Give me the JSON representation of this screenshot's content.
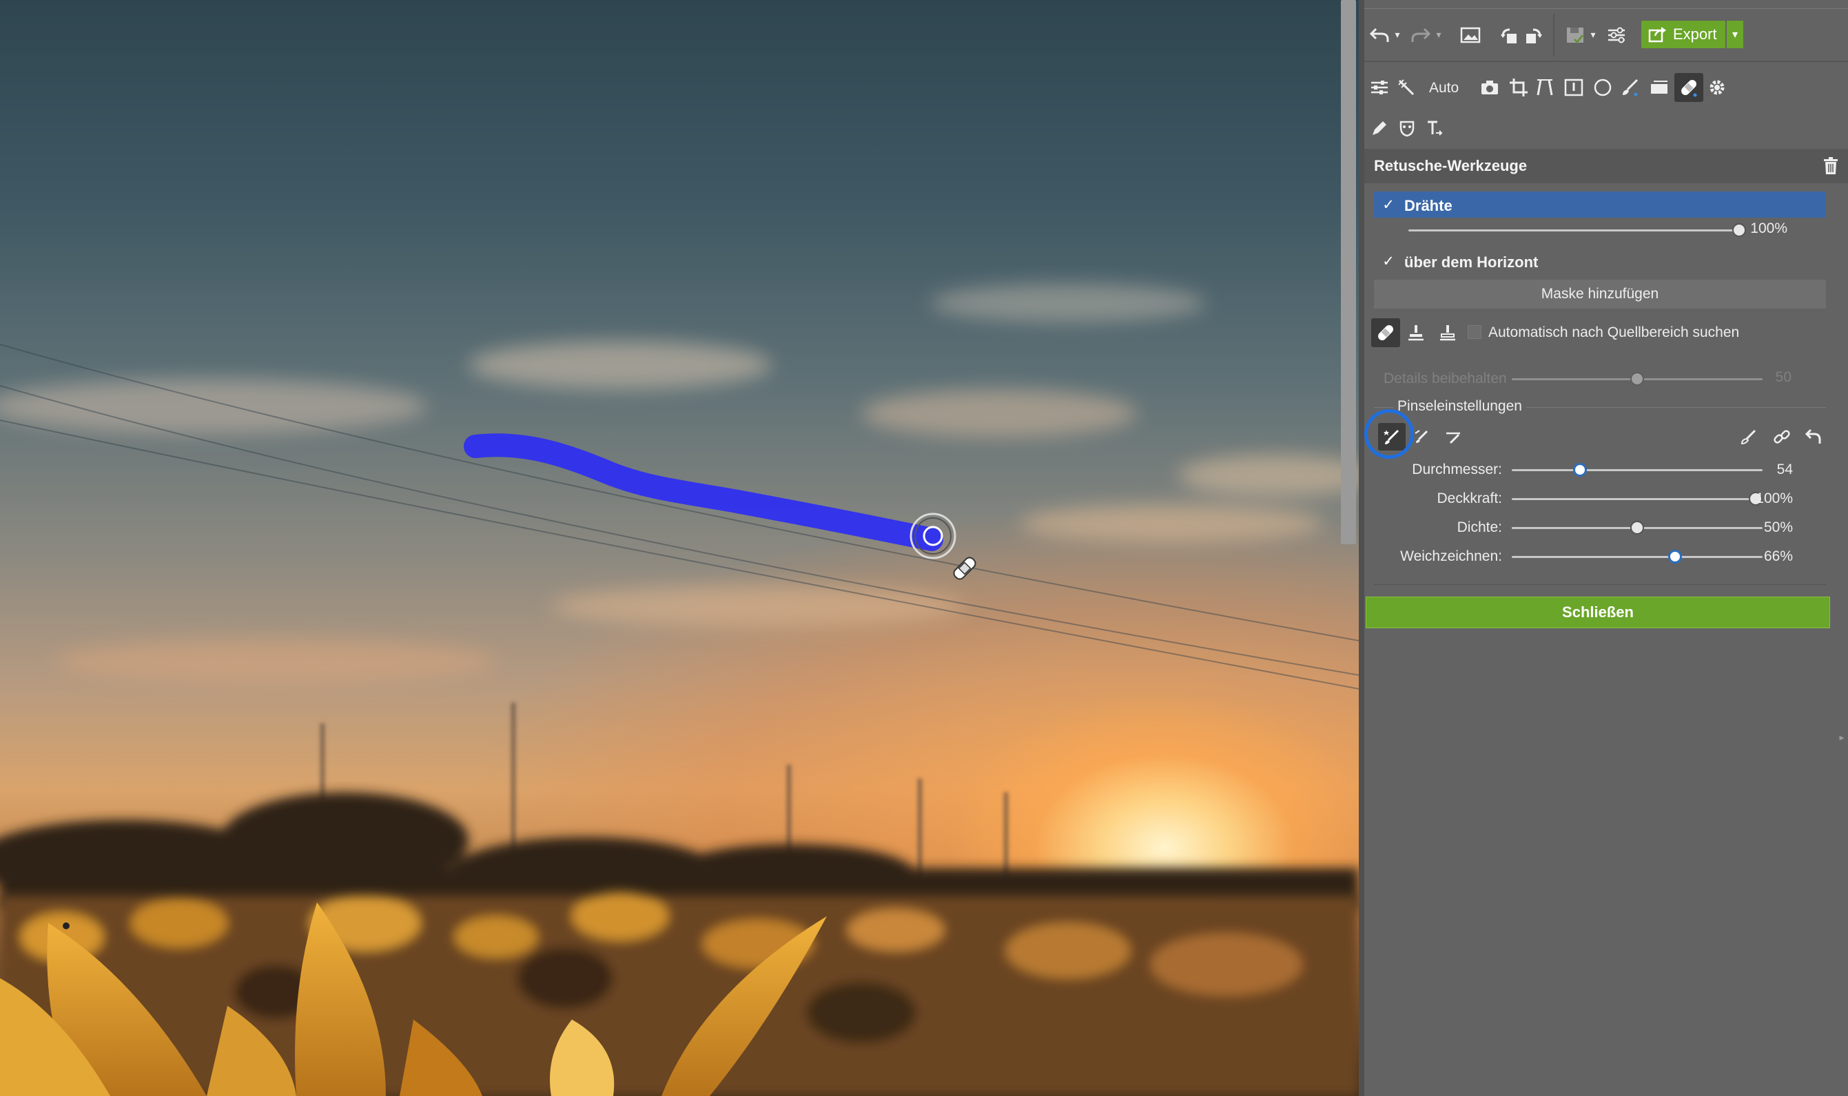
{
  "colors": {
    "accent_green": "#6aa629",
    "selection_blue": "#3a67a7",
    "brush_stroke": "#2f2ff0",
    "highlight_ring": "#1f6fe0"
  },
  "toolbar": {
    "export_label": "Export",
    "auto_label": "Auto",
    "icons": [
      "undo-icon",
      "redo-icon",
      "image-icon",
      "rotate-left-icon",
      "rotate-right-icon",
      "save-icon",
      "settings-sliders-icon",
      "export-icon"
    ]
  },
  "tools_row": {
    "icons": [
      "adjustments-icon",
      "magic-wand-icon",
      "camera-icon",
      "crop-icon",
      "perspective-icon",
      "frame-icon",
      "circle-icon",
      "brush-icon",
      "gradient-icon",
      "retouch-icon",
      "gear-icon",
      "pen-icon",
      "mask-icon",
      "text-icon"
    ]
  },
  "section": {
    "title": "Retusche-Werkzeuge",
    "delete_icon": "trash-icon"
  },
  "layer": {
    "name": "Drähte",
    "checked": true,
    "opacity_value": "100%",
    "opacity_fraction": 1.0
  },
  "mask": {
    "name": "über dem Horizont",
    "checked": true,
    "add_mask_label": "Maske hinzufügen"
  },
  "retouch_modes": {
    "auto_search_label": "Automatisch nach Quellbereich suchen",
    "auto_search_checked": false
  },
  "details": {
    "label": "Details beibehalten",
    "value": "50",
    "fraction": 0.5
  },
  "brush": {
    "heading": "Pinseleinstellungen",
    "sliders": [
      {
        "label": "Durchmesser:",
        "value": "54",
        "fraction": 0.26
      },
      {
        "label": "Deckkraft:",
        "value": "100%",
        "fraction": 1.0
      },
      {
        "label": "Dichte:",
        "value": "50%",
        "fraction": 0.5
      },
      {
        "label": "Weichzeichnen:",
        "value": "66%",
        "fraction": 0.66
      }
    ]
  },
  "close_label": "Schließen"
}
